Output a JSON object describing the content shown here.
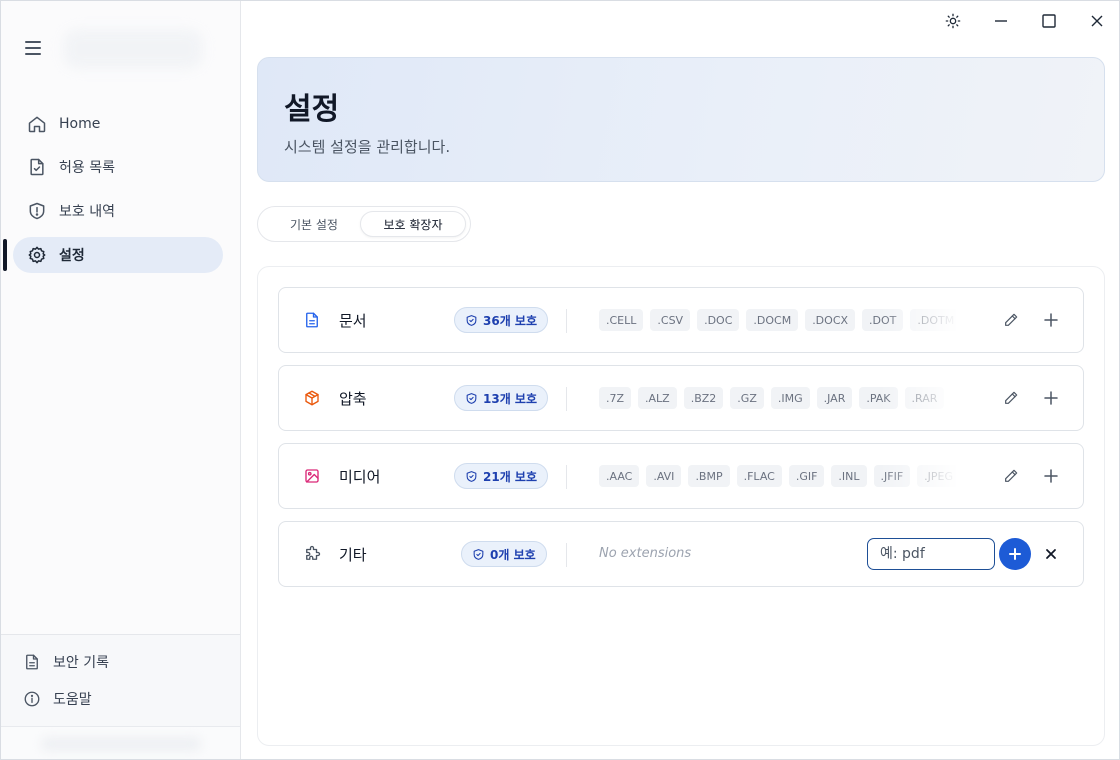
{
  "sidebar": {
    "nav": [
      {
        "label": "Home",
        "icon": "home-icon"
      },
      {
        "label": "허용 목록",
        "icon": "file-check-icon"
      },
      {
        "label": "보호 내역",
        "icon": "shield-alert-icon"
      },
      {
        "label": "설정",
        "icon": "gear-icon",
        "active": true
      }
    ],
    "footer": [
      {
        "label": "보안 기록",
        "icon": "document-icon"
      },
      {
        "label": "도움말",
        "icon": "info-icon"
      }
    ]
  },
  "header": {
    "title": "설정",
    "subtitle": "시스템 설정을 관리합니다."
  },
  "tabs": [
    {
      "label": "기본 설정",
      "active": false
    },
    {
      "label": "보호 확장자",
      "active": true
    }
  ],
  "categories": [
    {
      "name": "문서",
      "icon": "document-icon",
      "icon_color": "#2563eb",
      "badge": "36개 보호",
      "extensions": [
        ".CELL",
        ".CSV",
        ".DOC",
        ".DOCM",
        ".DOCX",
        ".DOT",
        ".DOTM"
      ]
    },
    {
      "name": "압축",
      "icon": "box-icon",
      "icon_color": "#ea580c",
      "badge": "13개 보호",
      "extensions": [
        ".7Z",
        ".ALZ",
        ".BZ2",
        ".GZ",
        ".IMG",
        ".JAR",
        ".PAK",
        ".RAR"
      ]
    },
    {
      "name": "미디어",
      "icon": "image-icon",
      "icon_color": "#db2777",
      "badge": "21개 보호",
      "extensions": [
        ".AAC",
        ".AVI",
        ".BMP",
        ".FLAC",
        ".GIF",
        ".INL",
        ".JFIF",
        ".JPEG"
      ]
    },
    {
      "name": "기타",
      "icon": "puzzle-icon",
      "icon_color": "#4b5563",
      "badge": "0개 보호",
      "empty_text": "No extensions",
      "input_placeholder": "예: pdf"
    }
  ],
  "colors": {
    "accent": "#1d5bd6",
    "badge_text": "#1e40af",
    "active_nav_bg": "#e4ebf7"
  }
}
